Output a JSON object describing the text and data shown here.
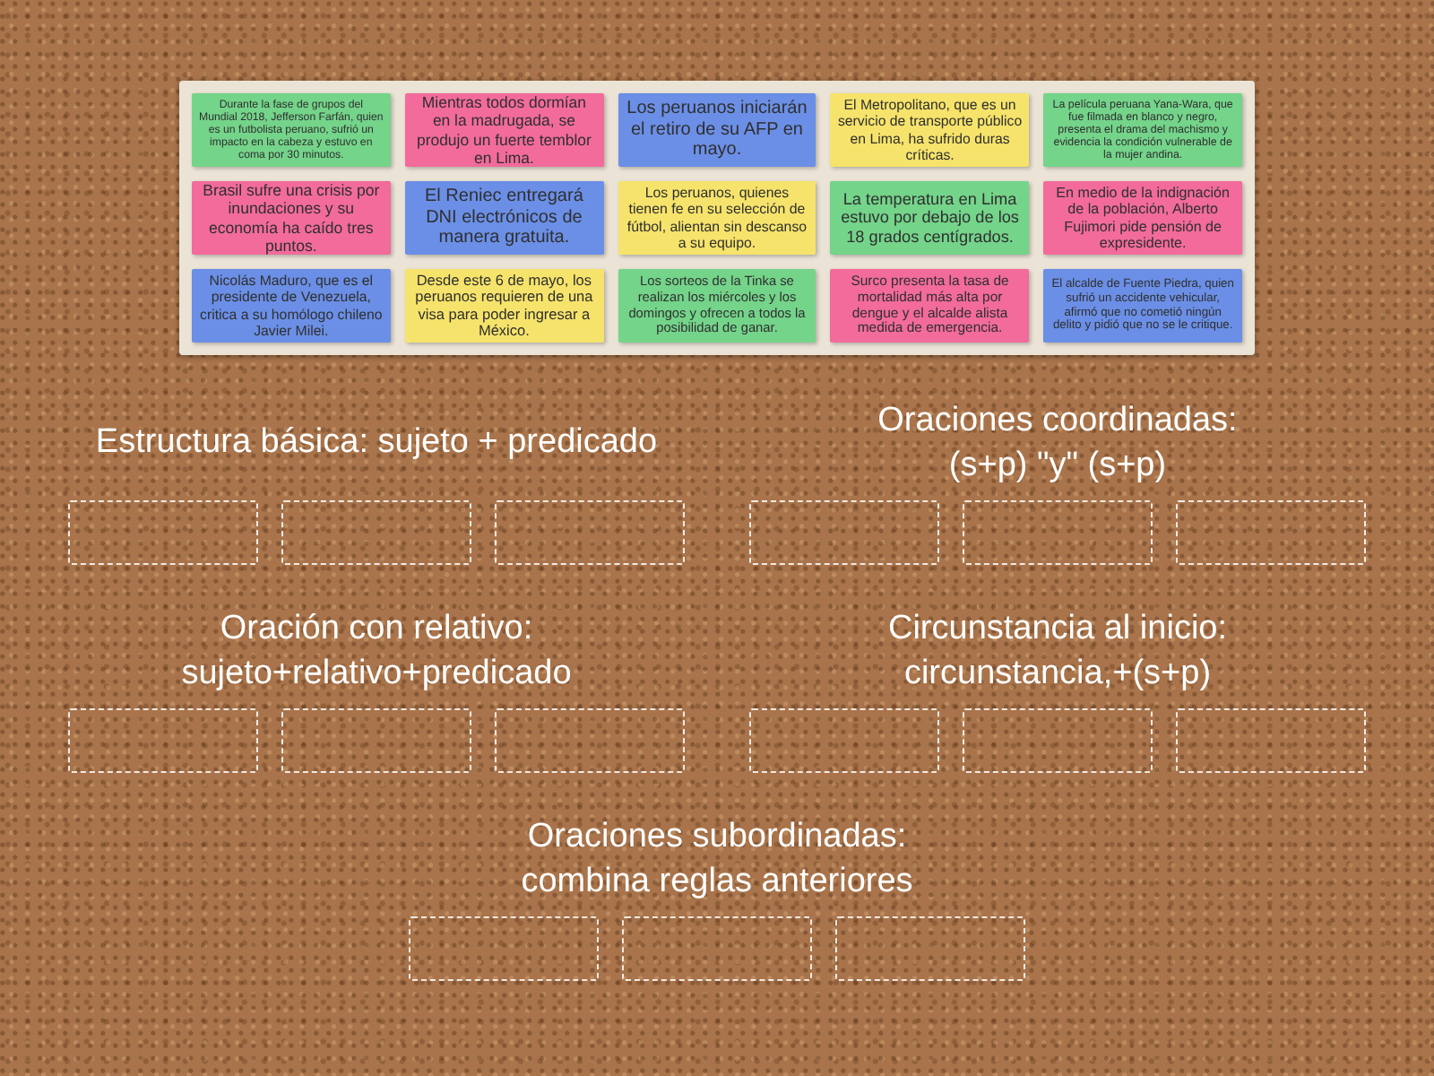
{
  "board": {
    "cards": [
      {
        "text": "Durante la fase de grupos del Mundial 2018, Jefferson Farfán, quien es un futbolista peruano, sufrió un impacto en la cabeza y estuvo en coma por 30 minutos.",
        "color": "#74d48a"
      },
      {
        "text": "Mientras todos dormían en la madrugada, se produjo un fuerte temblor en Lima.",
        "color": "#f26b9b"
      },
      {
        "text": "Los peruanos iniciarán el retiro de su AFP en mayo.",
        "color": "#6b8fe6"
      },
      {
        "text": "El Metropolitano, que es un servicio de transporte público en Lima, ha sufrido duras críticas.",
        "color": "#f6e36b"
      },
      {
        "text": "La película peruana Yana-Wara, que fue filmada en blanco y negro, presenta el drama del machismo y evidencia la condición vulnerable de la mujer andina.",
        "color": "#74d48a"
      },
      {
        "text": "Brasil sufre una crisis por inundaciones y su economía ha caído tres puntos.",
        "color": "#f26b9b"
      },
      {
        "text": "El Reniec entregará DNI electrónicos de manera gratuita.",
        "color": "#6b8fe6"
      },
      {
        "text": "Los peruanos, quienes tienen fe en su selección de fútbol, alientan sin descanso a su equipo.",
        "color": "#f6e36b"
      },
      {
        "text": "La temperatura en Lima estuvo por debajo de los 18 grados centígrados.",
        "color": "#74d48a"
      },
      {
        "text": "En medio de la indignación de la población, Alberto Fujimori pide pensión de expresidente.",
        "color": "#f26b9b"
      },
      {
        "text": "Nicolás Maduro, que es el presidente de Venezuela, critica a su homólogo chileno Javier Milei.",
        "color": "#6b8fe6"
      },
      {
        "text": "Desde este 6 de mayo, los peruanos requieren de una visa para poder ingresar a México.",
        "color": "#f6e36b"
      },
      {
        "text": "Los sorteos de la Tinka se realizan los miércoles y los domingos y ofrecen a todos la posibilidad de ganar.",
        "color": "#74d48a"
      },
      {
        "text": "Surco presenta la tasa de mortalidad más alta por dengue y el alcalde alista medida de emergencia.",
        "color": "#f26b9b"
      },
      {
        "text": "El alcalde de Fuente Piedra, quien sufrió un accidente vehicular, afirmó que no cometió ningún delito y pidió que no se le critique.",
        "color": "#6b8fe6"
      }
    ]
  },
  "groups": [
    {
      "title": "Estructura básica: sujeto + predicado",
      "slots": [
        {
          "kind": "empty"
        },
        {
          "kind": "empty"
        },
        {
          "kind": "empty"
        }
      ]
    },
    {
      "title": "Oraciones coordinadas:\n(s+p) \"y\" (s+p)",
      "slots": [
        {
          "kind": "empty"
        },
        {
          "kind": "empty"
        },
        {
          "kind": "empty"
        }
      ]
    },
    {
      "title": "Oración con relativo:\nsujeto+relativo+predicado",
      "slots": [
        {
          "kind": "empty"
        },
        {
          "kind": "empty"
        },
        {
          "kind": "empty"
        }
      ]
    },
    {
      "title": "Circunstancia al inicio:\ncircunstancia,+(s+p)",
      "slots": [
        {
          "kind": "empty"
        },
        {
          "kind": "empty"
        },
        {
          "kind": "empty"
        }
      ]
    },
    {
      "title": "Oraciones subordinadas:\ncombina reglas anteriores",
      "slots": [
        {
          "kind": "empty"
        },
        {
          "kind": "empty"
        },
        {
          "kind": "empty"
        }
      ]
    }
  ]
}
